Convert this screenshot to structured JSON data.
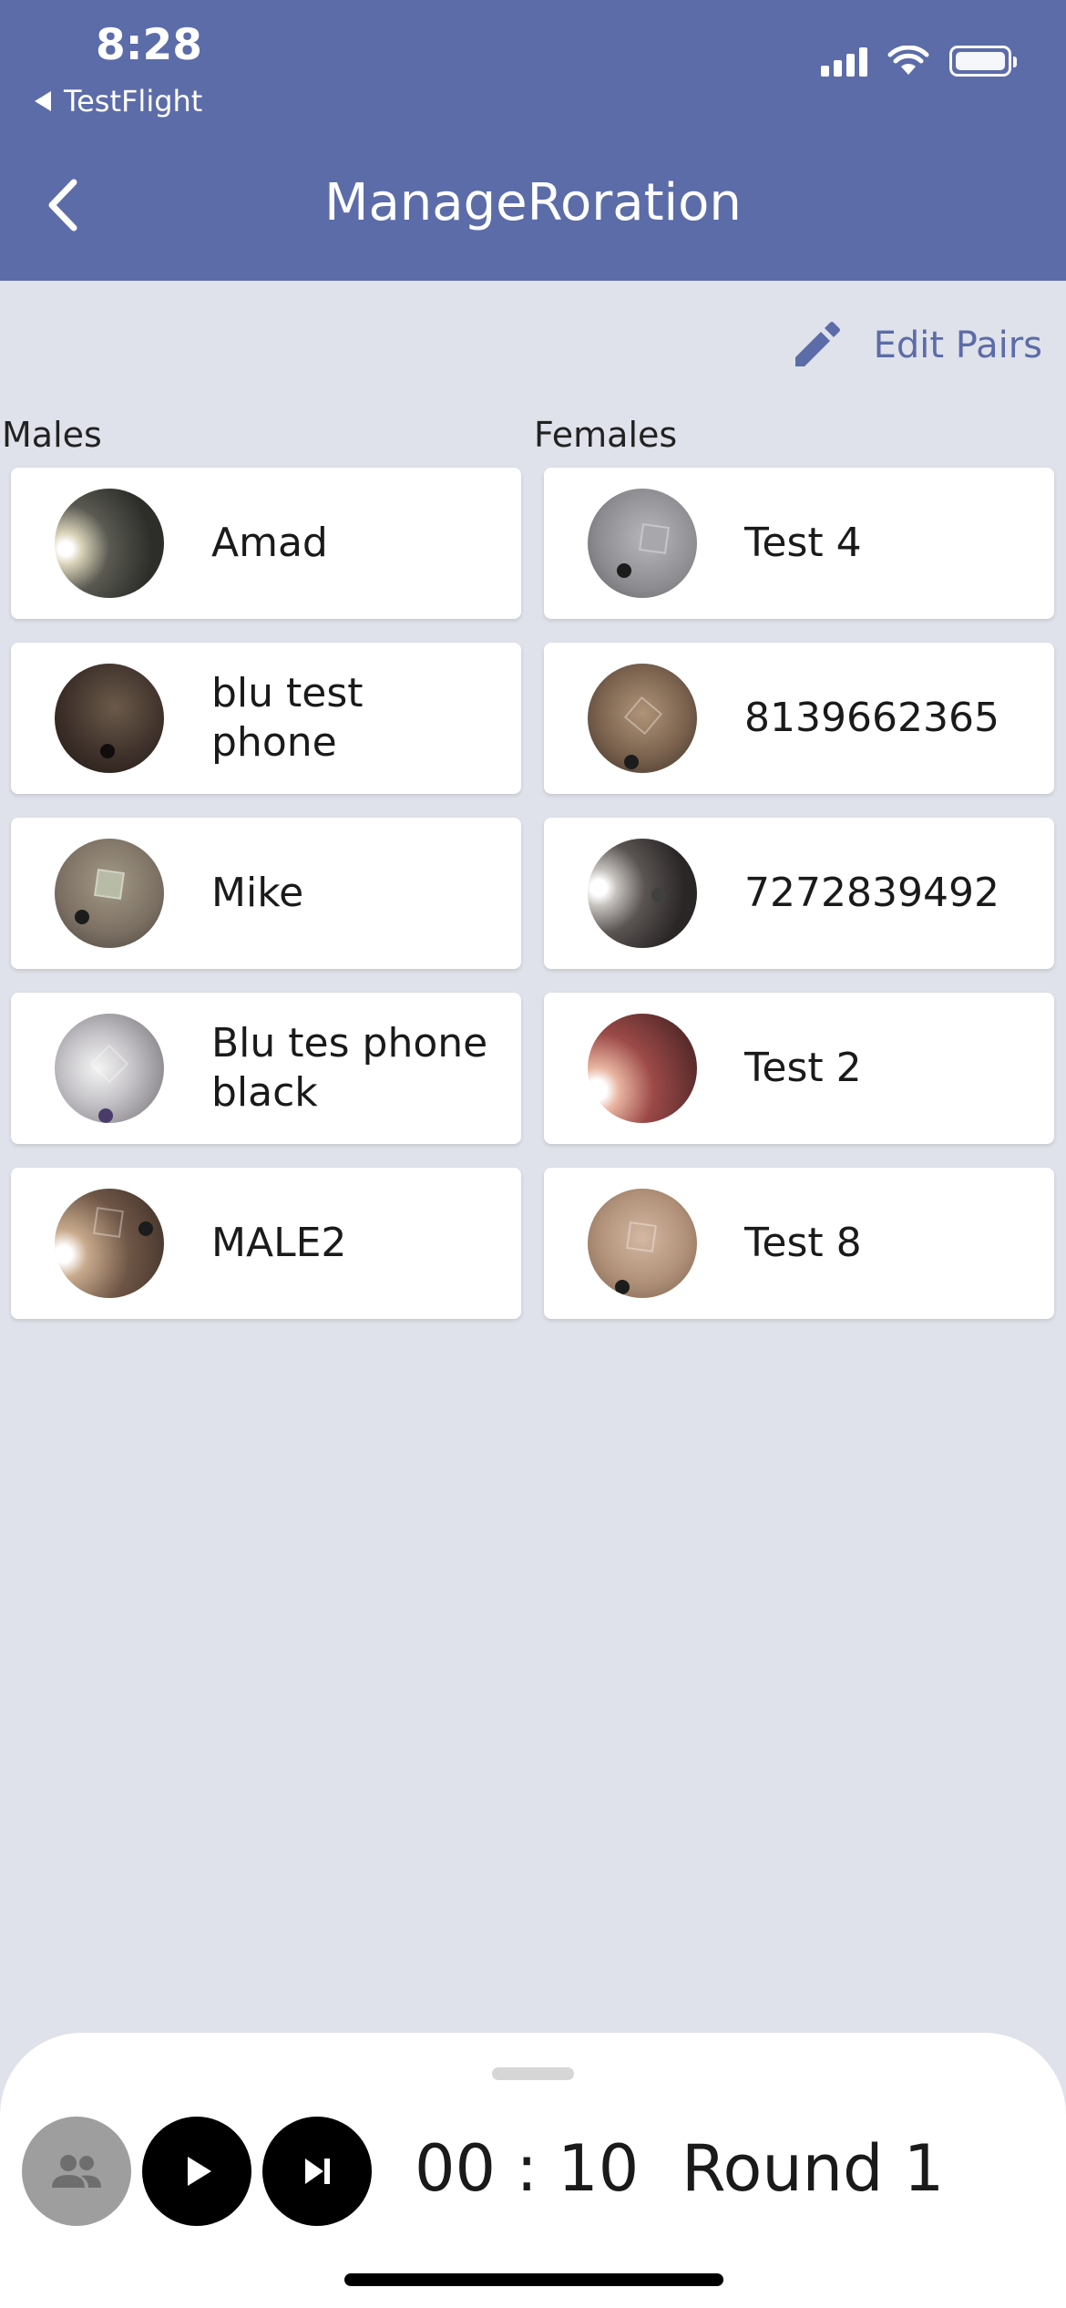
{
  "status_bar": {
    "time": "8:28",
    "back_app": "TestFlight"
  },
  "nav": {
    "title": "ManageRoration",
    "back_icon": "chevron-left-icon"
  },
  "edit_pairs": {
    "label": "Edit Pairs",
    "icon": "pencil-icon"
  },
  "males": {
    "label": "Males",
    "items": [
      {
        "name": "Amad"
      },
      {
        "name": "blu test phone"
      },
      {
        "name": "Mike"
      },
      {
        "name": "Blu tes phone black"
      },
      {
        "name": "MALE2"
      }
    ]
  },
  "females": {
    "label": "Females",
    "items": [
      {
        "name": "Test 4"
      },
      {
        "name": "8139662365"
      },
      {
        "name": "7272839492"
      },
      {
        "name": "Test 2"
      },
      {
        "name": "Test 8"
      }
    ]
  },
  "controls": {
    "group_icon": "people-icon",
    "play_icon": "play-icon",
    "next_icon": "skip-next-icon",
    "timer": "00 : 10",
    "round": "Round 1"
  },
  "colors": {
    "header": "#5c6ca8",
    "background": "#dfe2ea",
    "accent": "#5c6ca8"
  }
}
